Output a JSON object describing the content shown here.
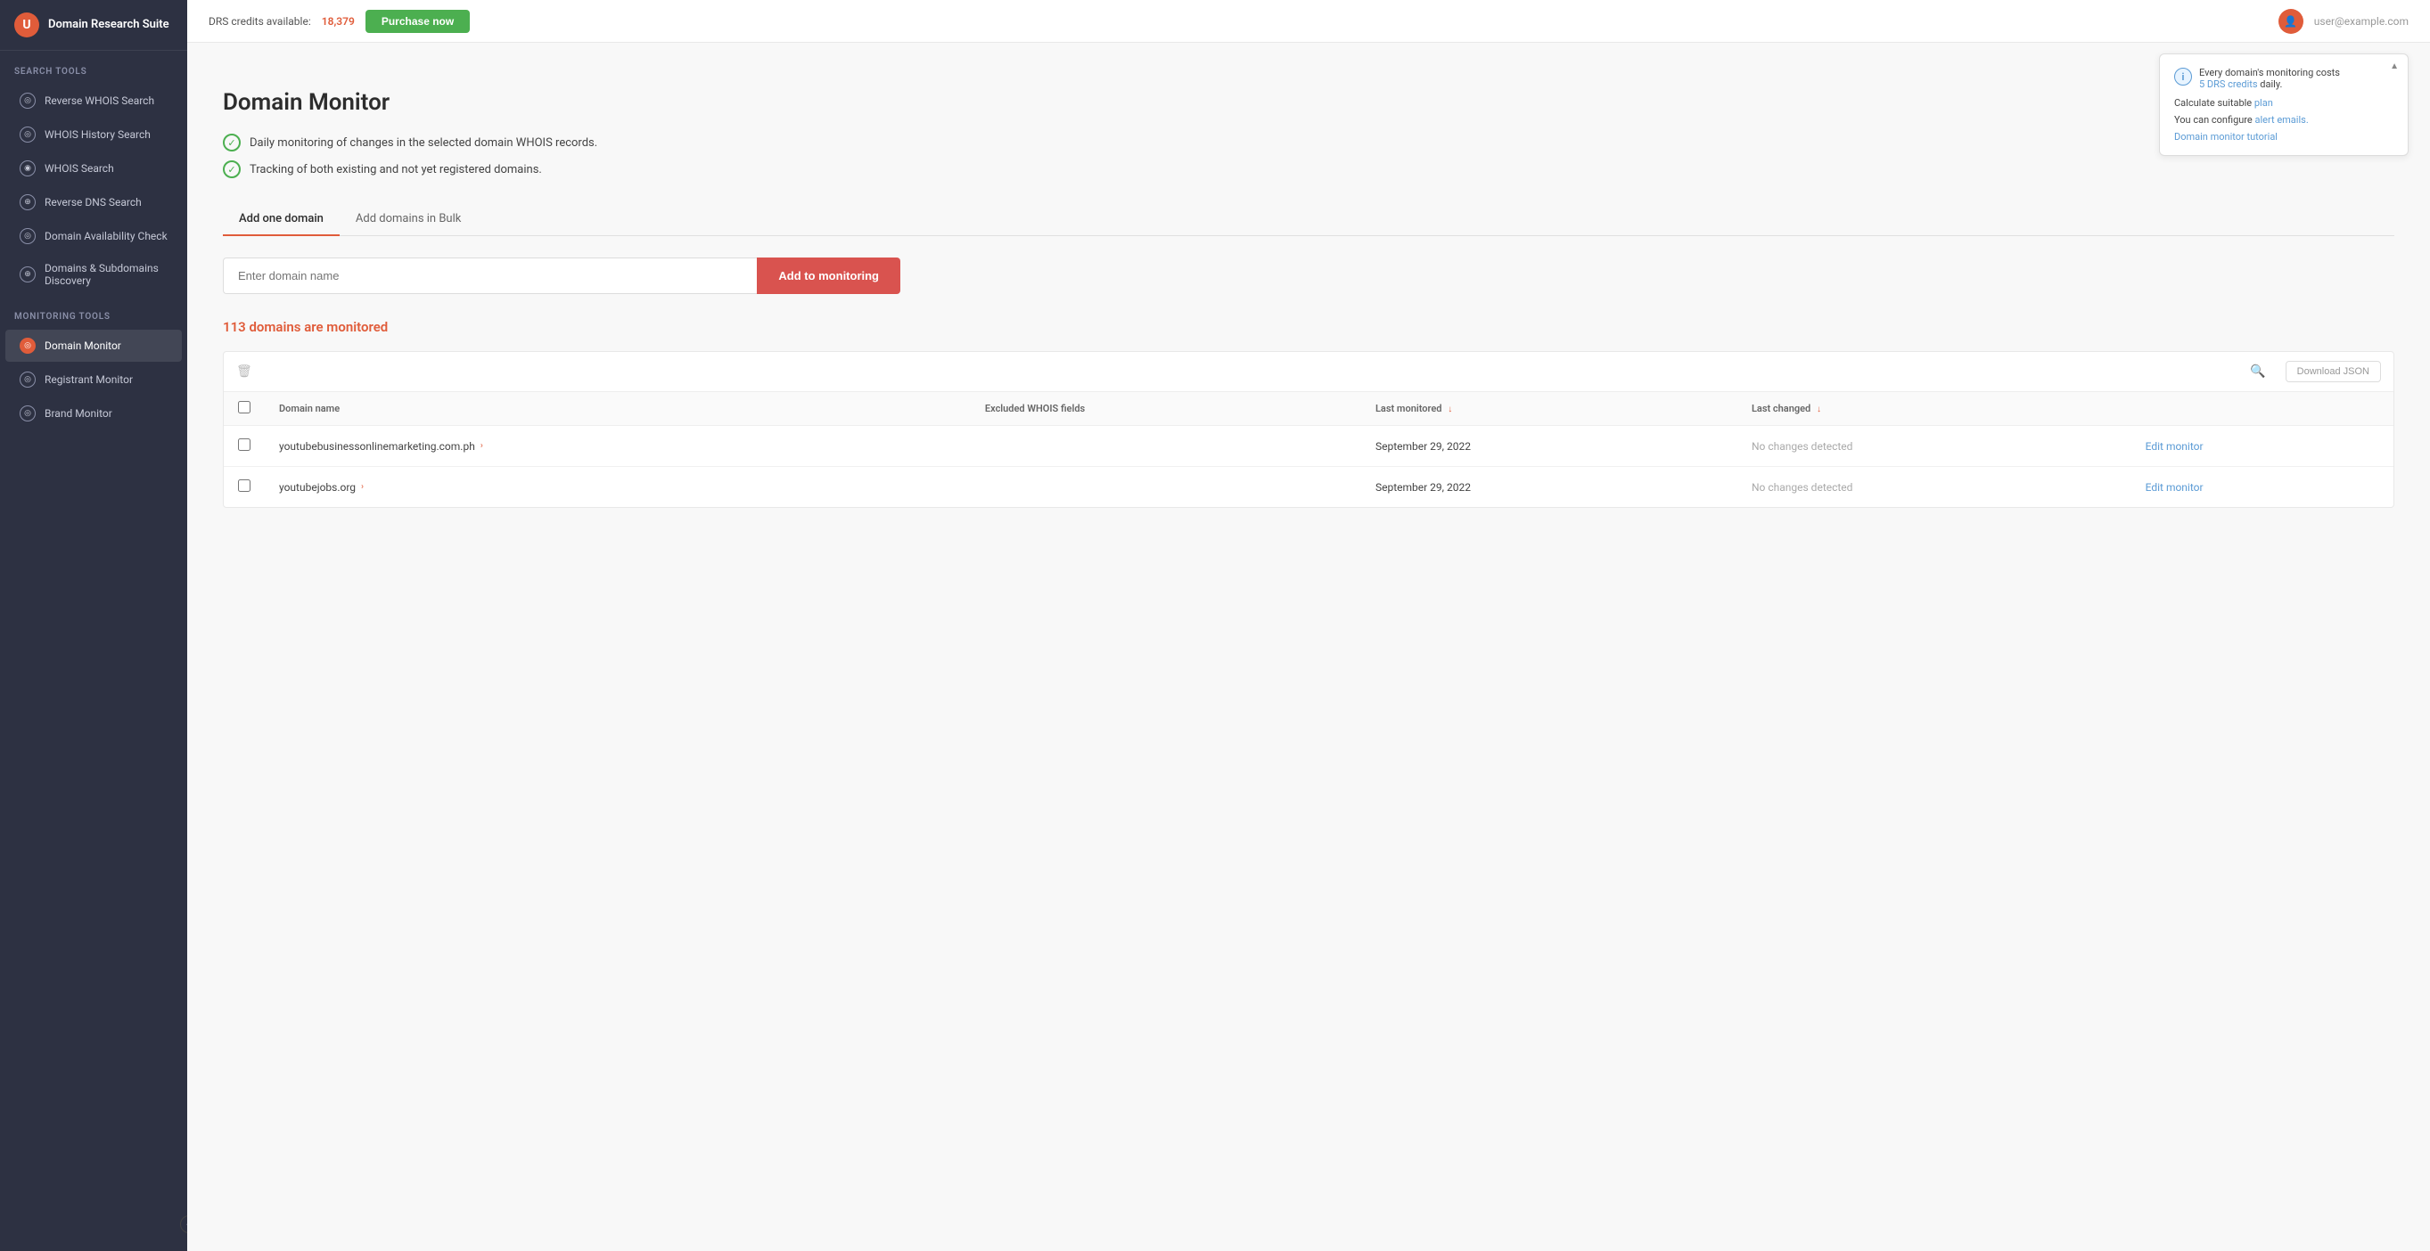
{
  "app": {
    "title": "Domain Research Suite",
    "logo_letter": "U"
  },
  "topbar": {
    "credits_label": "DRS credits available:",
    "credits_count": "18,379",
    "purchase_label": "Purchase now",
    "user_email": "user@example.com"
  },
  "sidebar": {
    "search_tools_label": "Search tools",
    "monitoring_tools_label": "Monitoring tools",
    "search_items": [
      {
        "id": "reverse-whois",
        "label": "Reverse WHOIS Search",
        "icon": "◎"
      },
      {
        "id": "whois-history",
        "label": "WHOIS History Search",
        "icon": "◎"
      },
      {
        "id": "whois-search",
        "label": "WHOIS Search",
        "icon": "◉"
      },
      {
        "id": "reverse-dns",
        "label": "Reverse DNS Search",
        "icon": "⊕"
      },
      {
        "id": "domain-availability",
        "label": "Domain Availability Check",
        "icon": "◎"
      },
      {
        "id": "domains-discovery",
        "label": "Domains & Subdomains Discovery",
        "icon": "⊕"
      }
    ],
    "monitoring_items": [
      {
        "id": "domain-monitor",
        "label": "Domain Monitor",
        "icon": "◎",
        "active": true
      },
      {
        "id": "registrant-monitor",
        "label": "Registrant Monitor",
        "icon": "◎"
      },
      {
        "id": "brand-monitor",
        "label": "Brand Monitor",
        "icon": "◎"
      }
    ],
    "collapse_icon": "◄"
  },
  "tooltip": {
    "info_icon": "i",
    "line1": "Every domain's monitoring costs",
    "credits_text": "5 DRS credits",
    "line1_suffix": "daily.",
    "line2_prefix": "Calculate suitable",
    "plan_link": "plan",
    "line3_prefix": "You can configure",
    "alert_link": "alert emails.",
    "tutorial_link": "Domain monitor tutorial"
  },
  "page": {
    "title": "Domain Monitor",
    "feature1": "Daily monitoring of changes in the selected domain WHOIS records.",
    "feature2": "Tracking of both existing and not yet registered domains.",
    "tab_add_one": "Add one domain",
    "tab_add_bulk": "Add domains in Bulk",
    "input_placeholder": "Enter domain name",
    "add_button": "Add to monitoring",
    "monitored_prefix": "",
    "monitored_count": "113",
    "monitored_suffix": "domains are monitored"
  },
  "table": {
    "download_btn": "Download JSON",
    "columns": [
      {
        "id": "domain-name",
        "label": "Domain name",
        "sortable": false
      },
      {
        "id": "excluded-fields",
        "label": "Excluded WHOIS fields",
        "sortable": false
      },
      {
        "id": "last-monitored",
        "label": "Last monitored",
        "sortable": true
      },
      {
        "id": "last-changed",
        "label": "Last changed",
        "sortable": true
      }
    ],
    "rows": [
      {
        "domain": "youtubebusinessonlinemarketing.com.ph",
        "excluded_fields": "",
        "last_monitored": "September 29, 2022",
        "last_changed": "No changes detected",
        "edit_label": "Edit monitor"
      },
      {
        "domain": "youtubejobs.org",
        "excluded_fields": "",
        "last_monitored": "September 29, 2022",
        "last_changed": "No changes detected",
        "edit_label": "Edit monitor"
      }
    ]
  }
}
